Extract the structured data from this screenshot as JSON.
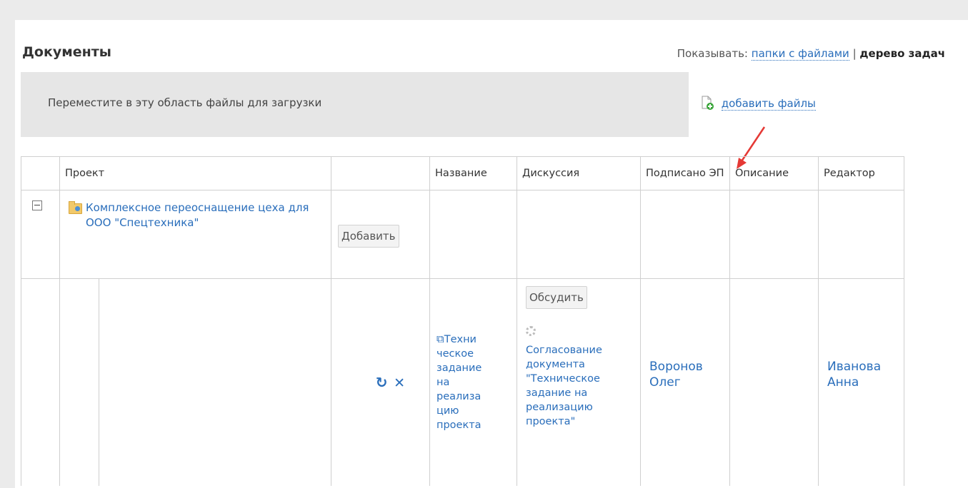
{
  "header": {
    "title": "Документы",
    "show_label": "Показывать:",
    "view_folders": "папки с файлами",
    "separator": "|",
    "view_tree": "дерево задач"
  },
  "upload": {
    "dropzone_text": "Переместите в эту область файлы для загрузки",
    "add_files_label": "добавить файлы"
  },
  "table": {
    "columns": [
      "Проект",
      "",
      "Название",
      "Дискуссия",
      "Подписано ЭП",
      "Описание",
      "Редактор"
    ],
    "project_row": {
      "project_name": "Комплексное переоснащение цеха для ООО \"Спецтехника\"",
      "add_button": "Добавить"
    },
    "document_row": {
      "name_lines": [
        "Техни",
        "ческое",
        "задание",
        "на",
        "реализа",
        "цию",
        "проекта"
      ],
      "discuss_button": "Обсудить",
      "approval_lines": [
        "Согласование",
        "документа",
        "\"Техническое",
        "задание на",
        "реализацию",
        "проекта\""
      ],
      "signed_by": "Воронов Олег",
      "description": "",
      "editor": "Иванова Анна"
    }
  },
  "colors": {
    "link": "#2a6ebb",
    "arrow": "#e53935",
    "dropzone_bg": "#e6e6e6"
  },
  "icons": [
    "folder-user-icon",
    "collapse-icon",
    "file-add-icon",
    "refresh-icon",
    "delete-icon",
    "copy-icon",
    "gear-icon"
  ]
}
